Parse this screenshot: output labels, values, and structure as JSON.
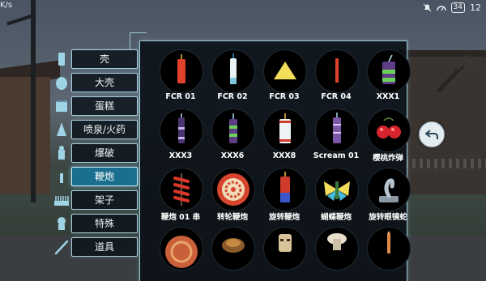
{
  "status": {
    "network_speed": "K/s",
    "battery": "34",
    "time": "12"
  },
  "categories": [
    {
      "label": "壳",
      "icon": "shell-cylinder-icon",
      "active": false
    },
    {
      "label": "大壳",
      "icon": "big-shell-icon",
      "active": false
    },
    {
      "label": "蛋糕",
      "icon": "cake-icon",
      "active": false
    },
    {
      "label": "喷泉/火药",
      "icon": "fountain-cone-icon",
      "active": false
    },
    {
      "label": "爆破",
      "icon": "blast-icon",
      "active": false
    },
    {
      "label": "鞭炮",
      "icon": "firecracker-icon",
      "active": true
    },
    {
      "label": "架子",
      "icon": "rack-icon",
      "active": false
    },
    {
      "label": "特殊",
      "icon": "special-icon",
      "active": false
    },
    {
      "label": "道具",
      "icon": "tool-stick-icon",
      "active": false
    }
  ],
  "items": [
    {
      "label": "FCR 01",
      "icon": "red-firecracker-icon"
    },
    {
      "label": "FCR 02",
      "icon": "white-firecracker-icon"
    },
    {
      "label": "FCR 03",
      "icon": "yellow-triangle-icon"
    },
    {
      "label": "FCR 04",
      "icon": "thin-red-stick-icon"
    },
    {
      "label": "XXX1",
      "icon": "purple-green-cylinder-icon"
    },
    {
      "label": "XXX3",
      "icon": "purple-stick-icon"
    },
    {
      "label": "XXX6",
      "icon": "purple-green-stick-icon"
    },
    {
      "label": "XXX8",
      "icon": "white-red-cylinder-icon"
    },
    {
      "label": "Scream 01",
      "icon": "purple-scream-cylinder-icon"
    },
    {
      "label": "樱桃炸弹",
      "icon": "cherry-bomb-icon"
    },
    {
      "label": "鞭炮 01 串",
      "icon": "firecracker-string-icon"
    },
    {
      "label": "转轮鞭炮",
      "icon": "wheel-firecracker-icon"
    },
    {
      "label": "旋转鞭炮",
      "icon": "spinning-firecracker-icon"
    },
    {
      "label": "蝴蝶鞭炮",
      "icon": "butterfly-firecracker-icon"
    },
    {
      "label": "旋转眼镜蛇",
      "icon": "cobra-icon"
    },
    {
      "label": "",
      "icon": "round-disc-icon"
    },
    {
      "label": "",
      "icon": "turtle-icon"
    },
    {
      "label": "",
      "icon": "tiki-icon"
    },
    {
      "label": "",
      "icon": "mushroom-icon"
    },
    {
      "label": "",
      "icon": "orange-rocket-icon"
    }
  ],
  "colors": {
    "accent": "#1b6f8e",
    "border": "#9fc8d6",
    "panel_bg": "#0a1016"
  }
}
